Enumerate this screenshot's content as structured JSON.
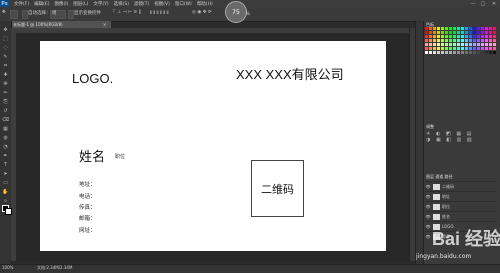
{
  "app": {
    "logo": "Ps",
    "menu": [
      "文件(F)",
      "编辑(E)",
      "图像(I)",
      "图层(L)",
      "文字(Y)",
      "选择(S)",
      "滤镜(T)",
      "视图(V)",
      "窗口(W)",
      "帮助(H)"
    ],
    "window_controls": [
      "—",
      "□",
      "✕"
    ]
  },
  "options_bar": {
    "auto_select": "自动选择：",
    "group": "组",
    "show_transform": "显示变换控件"
  },
  "zoom_badge": {
    "value": "75",
    "unit": "%"
  },
  "document_tab": {
    "title": "未标题-1 @ 100%(RGB/8)",
    "close": "×"
  },
  "canvas": {
    "logo": "LOGO.",
    "company": "XXX XXX有限公司",
    "name": "姓名",
    "title": "职位",
    "fields": [
      "地址：",
      "电话：",
      "传真：",
      "邮箱：",
      "网址："
    ],
    "qr_label": "二维码"
  },
  "panels": {
    "swatches_tab": "色板",
    "adjust_tab": "调整",
    "layers_tabs": "图层  通道  路径",
    "layers": [
      "二维码",
      "地址",
      "职位",
      "姓名",
      "LOGO.",
      "背景"
    ]
  },
  "status_bar": {
    "zoom": "100%",
    "doc": "文档:2.34M/2.34M"
  },
  "watermark": {
    "text": "Bai 经验",
    "url": "jingyan.baidu.com"
  },
  "colors": {
    "accent": "#0f4a86",
    "canvas_bg": "#ffffff",
    "ui_bg": "#2b2b2b"
  },
  "tools": [
    "move-tool",
    "marquee-tool",
    "lasso-tool",
    "quick-select-tool",
    "crop-tool",
    "eyedropper-tool",
    "healing-tool",
    "brush-tool",
    "clone-tool",
    "history-brush-tool",
    "eraser-tool",
    "gradient-tool",
    "blur-tool",
    "dodge-tool",
    "pen-tool",
    "type-tool",
    "path-select-tool",
    "shape-tool",
    "hand-tool",
    "zoom-tool"
  ]
}
